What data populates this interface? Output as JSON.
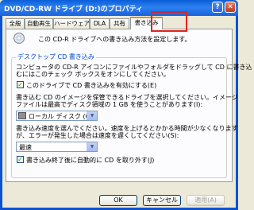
{
  "window": {
    "title": "DVD/CD-RW ドライブ (D:)のプロパティ",
    "help_glyph": "?",
    "close_glyph": "✕"
  },
  "tabs": [
    {
      "label": "全般"
    },
    {
      "label": "自動再生"
    },
    {
      "label": "ハードウェア"
    },
    {
      "label": "DLA"
    },
    {
      "label": "共有"
    },
    {
      "label": "書き込み",
      "active": true
    }
  ],
  "header": {
    "icon": "cd-icon",
    "text": "この CD-R ドライブへの書き込み方法を設定します。"
  },
  "group": {
    "title": "デスクトップ CD 書き込み",
    "desc_line1": "コンピュータの CD-R アイコンにファイルやフォルダをドラッグして CD に書き込",
    "desc_line2": "むにはこのチェック ボックスをオンにしてください。",
    "enable_checkbox": {
      "label": "このドライブで CD 書き込みを有効にする(E)",
      "checked": true
    },
    "image_desc_line1": "書き込む CD のイメージを保管できるドライブを選択してください。イメージ",
    "image_desc_line2": "ファイルは最高でディスク領域の 1 GB を使うことがあります(I):",
    "drive_select": {
      "value": "ローカル ディスク (C:)",
      "icon": "drive-icon"
    },
    "speed_desc_line1": "書き込み速度を選んでください。速度を上げるとかかる時間が少なくなります",
    "speed_desc_line2": "が、エラーが発生した場合は速度を遅くしてください(S):",
    "speed_select": {
      "value": "最速"
    },
    "eject_checkbox": {
      "label": "書き込み終了後に自動的に CD を取り外す(J)",
      "checked": true
    }
  },
  "buttons": {
    "ok": "OK",
    "cancel": "キャンセル",
    "apply": "適用(A)"
  }
}
